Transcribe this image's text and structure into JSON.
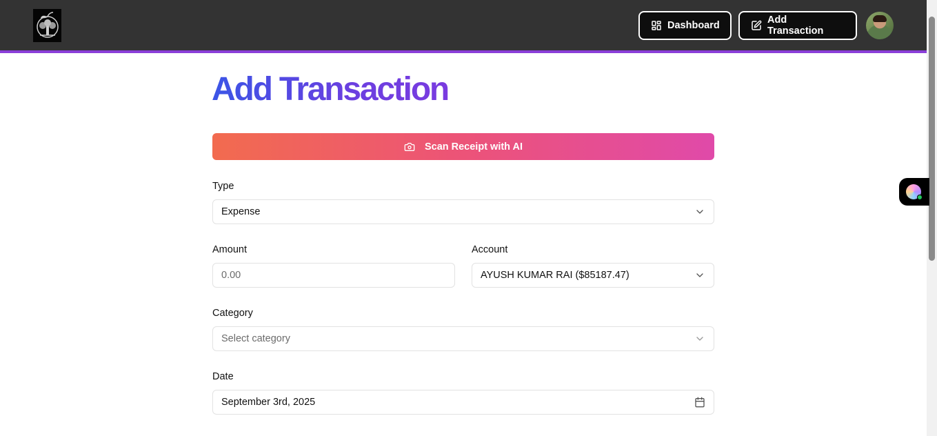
{
  "header": {
    "logo_icon": "apple-tree-logo-icon",
    "dashboard_label": "Dashboard",
    "dashboard_icon": "layout-dashboard-icon",
    "add_transaction_label": "Add Transaction",
    "add_transaction_icon": "pen-square-icon",
    "accent_color": "#8b3fd9"
  },
  "page": {
    "title": "Add Transaction"
  },
  "scan": {
    "label": "Scan Receipt with AI",
    "icon": "camera-icon"
  },
  "form": {
    "type": {
      "label": "Type",
      "value": "Expense"
    },
    "amount": {
      "label": "Amount",
      "placeholder": "0.00"
    },
    "account": {
      "label": "Account",
      "value": "AYUSH KUMAR RAI ($85187.47)"
    },
    "category": {
      "label": "Category",
      "placeholder": "Select category"
    },
    "date": {
      "label": "Date",
      "value": "September 3rd, 2025",
      "icon": "calendar-icon"
    }
  }
}
